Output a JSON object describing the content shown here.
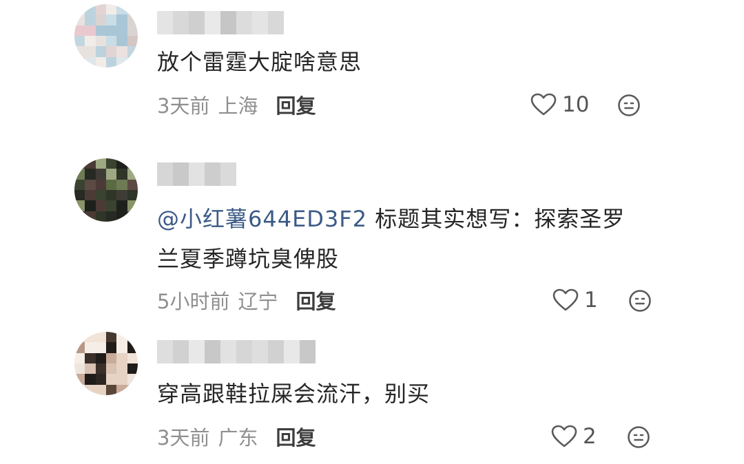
{
  "comments": [
    {
      "text": "放个雷霆大腚啥意思",
      "time": "3天前",
      "location": "上海",
      "reply_label": "回复",
      "likes": "10"
    },
    {
      "mention": "@小红薯644ED3F2",
      "text": " 标题其实想写：探索圣罗",
      "text_line2": "兰夏季蹲坑臭俾股",
      "time": "5小时前",
      "location": "辽宁",
      "reply_label": "回复",
      "likes": "1"
    },
    {
      "text": "穿高跟鞋拉屎会流汗，别买",
      "time": "3天前",
      "location": "广东",
      "reply_label": "回复",
      "likes": "2"
    }
  ],
  "icons": {
    "like": "heart-outline-icon",
    "dislike": "neutral-face-icon"
  },
  "colors": {
    "mention": "#3b5a86",
    "meta": "#8f8f8f",
    "text": "#252525"
  }
}
